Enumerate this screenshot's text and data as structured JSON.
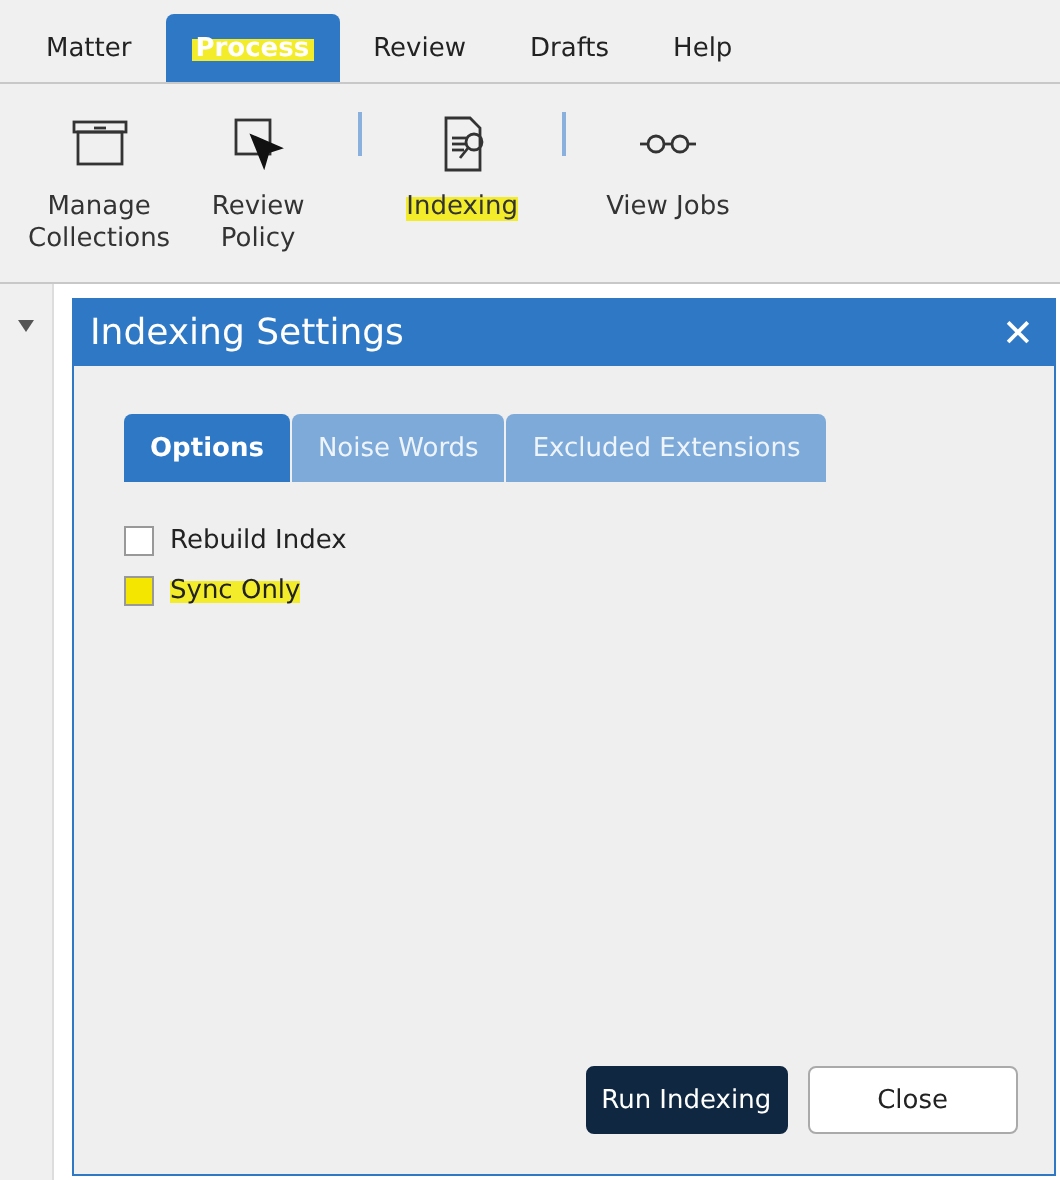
{
  "menu_tabs": [
    {
      "label": "Matter",
      "selected": false,
      "highlighted": false
    },
    {
      "label": "Process",
      "selected": true,
      "highlighted": true
    },
    {
      "label": "Review",
      "selected": false,
      "highlighted": false
    },
    {
      "label": "Drafts",
      "selected": false,
      "highlighted": false
    },
    {
      "label": "Help",
      "selected": false,
      "highlighted": false
    }
  ],
  "ribbon": [
    {
      "kind": "box",
      "label": "Manage\nCollections",
      "highlighted": false
    },
    {
      "kind": "cursor",
      "label": "Review\nPolicy",
      "highlighted": false
    },
    {
      "kind": "separator"
    },
    {
      "kind": "document",
      "label": "Indexing",
      "highlighted": true
    },
    {
      "kind": "separator"
    },
    {
      "kind": "glasses",
      "label": "View Jobs",
      "highlighted": false
    }
  ],
  "dialog": {
    "title": "Indexing Settings",
    "close": "✕",
    "tabs": [
      {
        "label": "Options",
        "selected": true
      },
      {
        "label": "Noise Words",
        "selected": false
      },
      {
        "label": "Excluded Extensions",
        "selected": false
      }
    ],
    "options": [
      {
        "label": "Rebuild Index",
        "checked": false,
        "highlighted": false
      },
      {
        "label": "Sync Only",
        "checked": false,
        "highlighted": true
      }
    ],
    "buttons": [
      {
        "label": "Run Indexing",
        "kind": "primary"
      },
      {
        "label": "Close",
        "kind": "secondary"
      }
    ]
  }
}
